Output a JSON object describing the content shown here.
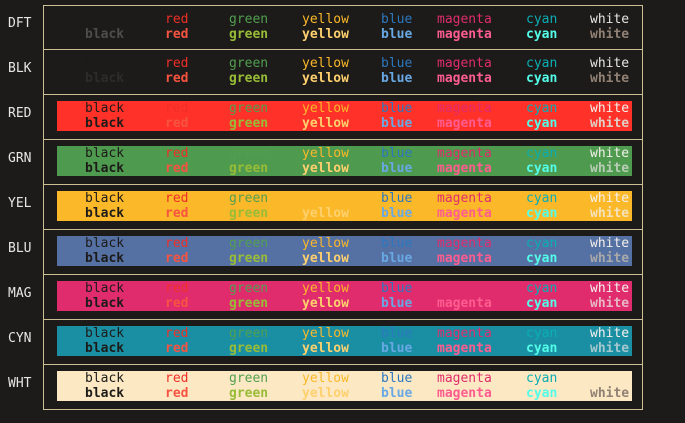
{
  "colors": {
    "page_bg": "#1c1b19",
    "border": "#cdbf94",
    "label": "#e8e6e3"
  },
  "words": [
    "black",
    "red",
    "green",
    "yellow",
    "blue",
    "magenta",
    "cyan",
    "white"
  ],
  "word_columns": [
    28,
    108,
    172,
    245,
    324,
    380,
    469,
    533
  ],
  "rows": [
    {
      "label": "DFT",
      "bg": null,
      "normal": [
        "#1c1b19",
        "#ef2f27",
        "#519f50",
        "#fbb829",
        "#2c78bf",
        "#e02c6d",
        "#0aaeb3",
        "#e8e6e3"
      ],
      "bold": [
        "#4d4d4d",
        "#f75341",
        "#98bc37",
        "#fed06e",
        "#68a8e4",
        "#ff5c8f",
        "#53fde9",
        "#918175"
      ]
    },
    {
      "label": "BLK",
      "bg": null,
      "normal": [
        "#1c1b19",
        "#ef2f27",
        "#519f50",
        "#fbb829",
        "#2c78bf",
        "#e02c6d",
        "#0aaeb3",
        "#e8e6e3"
      ],
      "bold": [
        "#2d2c2a",
        "#f75341",
        "#98bc37",
        "#fed06e",
        "#68a8e4",
        "#ff5c8f",
        "#53fde9",
        "#918175"
      ]
    },
    {
      "label": "RED",
      "bg": "#ff3128",
      "normal": [
        "#1c1b19",
        "#ef2f27",
        "#519f50",
        "#fbb829",
        "#2c78bf",
        "#e02c6d",
        "#0aaeb3",
        "#f4f1ec"
      ],
      "bold": [
        "#1c1b19",
        "#f75341",
        "#98bc37",
        "#fed06e",
        "#68a8e4",
        "#ff5c8f",
        "#53fde9",
        "#e2cfc5"
      ]
    },
    {
      "label": "GRN",
      "bg": "#4e9a4e",
      "normal": [
        "#1c1b19",
        "#ef2f27",
        "#519f50",
        "#fbb829",
        "#2c78bf",
        "#e02c6d",
        "#0aaeb3",
        "#f4f1ec"
      ],
      "bold": [
        "#1c1b19",
        "#f75341",
        "#98bc37",
        "#fed06e",
        "#68a8e4",
        "#ff5c8f",
        "#53fde9",
        "#b8cdb6"
      ]
    },
    {
      "label": "YEL",
      "bg": "#fbb829",
      "normal": [
        "#1c1b19",
        "#ef2f27",
        "#519f50",
        "#fbb829",
        "#2c78bf",
        "#e02c6d",
        "#0aaeb3",
        "#f4f1ec"
      ],
      "bold": [
        "#1c1b19",
        "#f75341",
        "#98bc37",
        "#fed06e",
        "#68a8e4",
        "#ff5c8f",
        "#53fde9",
        "#f5e2b8"
      ]
    },
    {
      "label": "BLU",
      "bg": "#5570a3",
      "normal": [
        "#1c1b19",
        "#ef2f27",
        "#519f50",
        "#fbb829",
        "#2c78bf",
        "#e02c6d",
        "#0aaeb3",
        "#f4f1ec"
      ],
      "bold": [
        "#1c1b19",
        "#f75341",
        "#98bc37",
        "#fed06e",
        "#68a8e4",
        "#ff5c8f",
        "#53fde9",
        "#a9a9a9"
      ]
    },
    {
      "label": "MAG",
      "bg": "#e02c6d",
      "normal": [
        "#1c1b19",
        "#ef2f27",
        "#519f50",
        "#fbb829",
        "#2c78bf",
        "#e02c6d",
        "#0aaeb3",
        "#f4f1ec"
      ],
      "bold": [
        "#1c1b19",
        "#f75341",
        "#98bc37",
        "#fed06e",
        "#68a8e4",
        "#ff5c8f",
        "#53fde9",
        "#e8b7c5"
      ]
    },
    {
      "label": "CYN",
      "bg": "#1a8fa3",
      "normal": [
        "#1c1b19",
        "#ef2f27",
        "#519f50",
        "#fbb829",
        "#2c78bf",
        "#e02c6d",
        "#0aaeb3",
        "#f4f1ec"
      ],
      "bold": [
        "#1c1b19",
        "#f75341",
        "#98bc37",
        "#fed06e",
        "#68a8e4",
        "#ff5c8f",
        "#53fde9",
        "#a4c7cd"
      ]
    },
    {
      "label": "WHT",
      "bg": "#fce8c3",
      "normal": [
        "#1c1b19",
        "#ef2f27",
        "#519f50",
        "#fbb829",
        "#2c78bf",
        "#e02c6d",
        "#0aaeb3",
        "#fce8c3"
      ],
      "bold": [
        "#1c1b19",
        "#f75341",
        "#98bc37",
        "#fed06e",
        "#68a8e4",
        "#ff5c8f",
        "#53fde9",
        "#918175"
      ]
    }
  ]
}
